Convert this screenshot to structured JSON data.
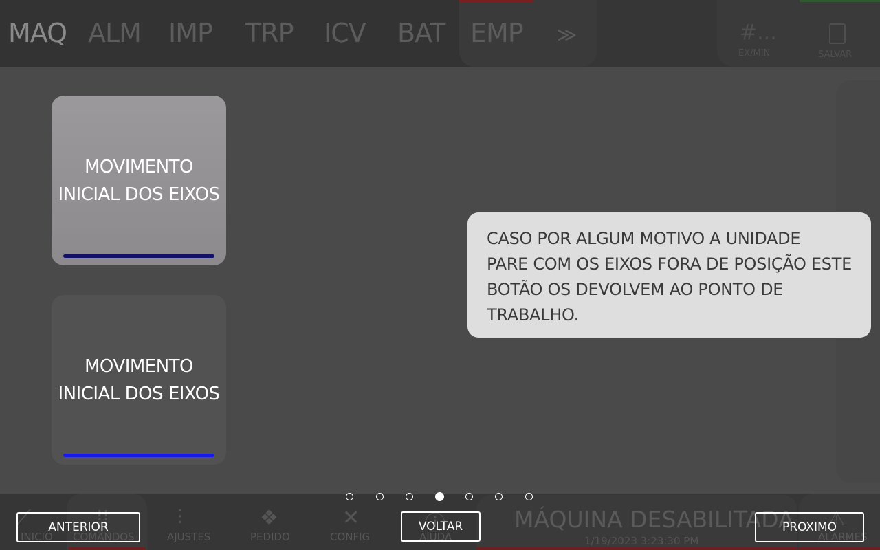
{
  "topbar": {
    "tabs": [
      "MAQ",
      "ALM",
      "IMP",
      "TRP",
      "ICV",
      "BAT",
      "EMP"
    ],
    "more_icon": "chevron-double-right-icon",
    "counter_value": "#...",
    "counter_label": "EX/MIN",
    "save_label": "SALVAR",
    "save_icon": "sd-card-icon"
  },
  "bottombar": {
    "nav": [
      "INICIO",
      "COMANDOS",
      "AJUSTES",
      "PEDIDO",
      "CONFIG",
      "AJUDA"
    ],
    "status_title": "MÁQUINA DESABILITADA",
    "status_time": "1/19/2023 3:23:30 PM",
    "alarm_label": "ALARMES"
  },
  "demo": {
    "button1_label": "MOVIMENTO INICIAL DOS EIXOS",
    "button2_label": "MOVIMENTO INICIAL DOS EIXOS"
  },
  "tooltip": {
    "text": "CASO POR ALGUM MOTIVO A UNIDADE\nPARE COM OS EIXOS FORA DE POSIÇÃO ESTE\nBOTÃO OS DEVOLVEM AO PONTO DE\nTRABALHO."
  },
  "pager": {
    "total": 7,
    "current": 4
  },
  "tour": {
    "prev_label": "ANTERIOR",
    "back_label": "VOLTAR",
    "next_label": "PROXIMO"
  },
  "colors": {
    "overlay_bg": "#4a4a4a",
    "tooltip_bg": "#dedede",
    "underline_dark": "#11116a",
    "underline_blue": "#1a1ae6"
  }
}
